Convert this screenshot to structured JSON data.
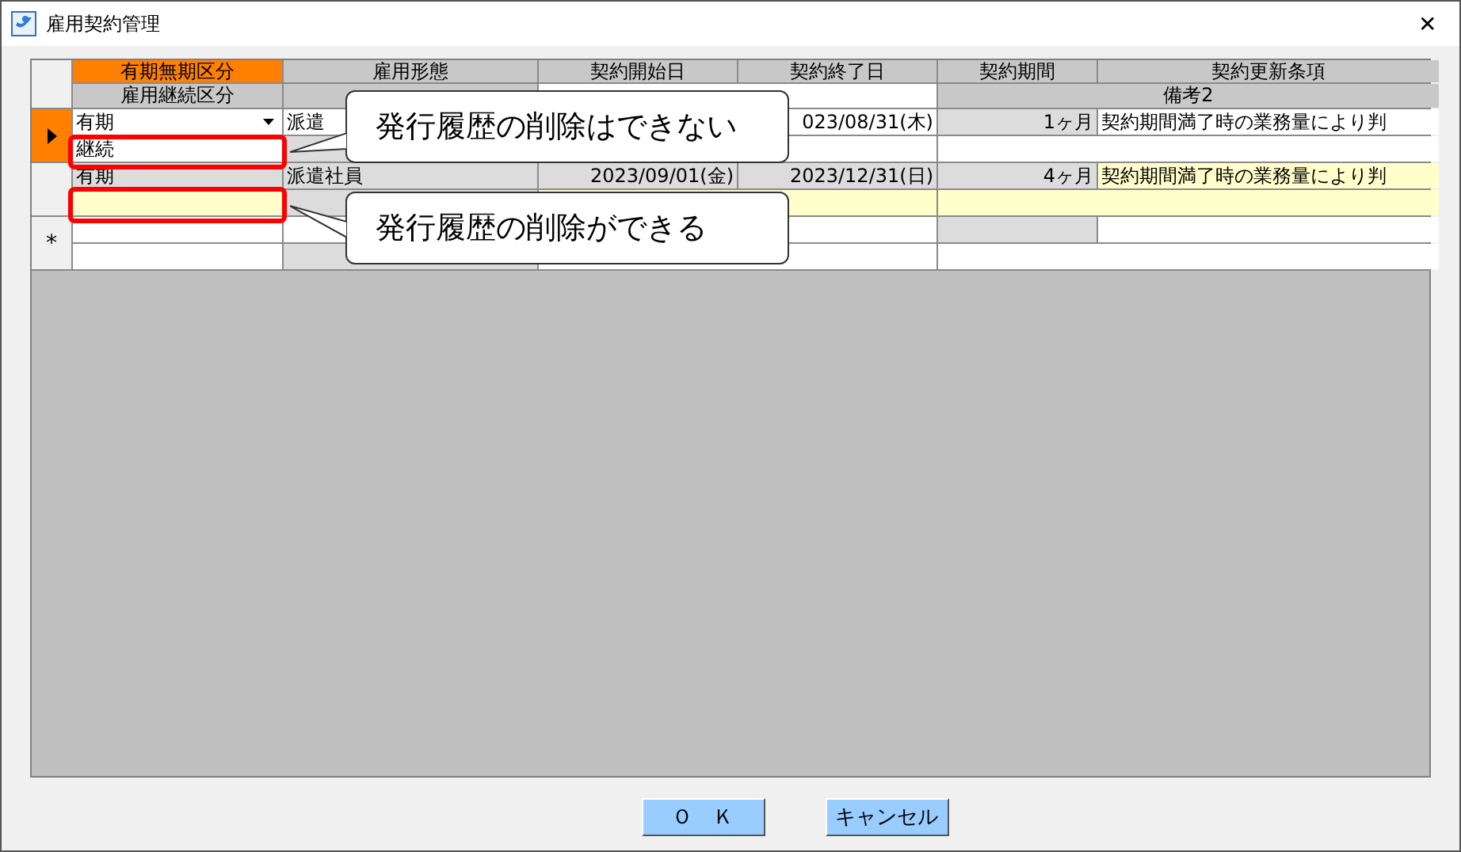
{
  "window": {
    "title": "雇用契約管理",
    "close": "✕"
  },
  "columns": [
    {
      "label": "有期無期区分",
      "selected": true
    },
    {
      "label": "雇用形態",
      "selected": false
    },
    {
      "label": "契約開始日",
      "selected": false
    },
    {
      "label": "契約終了日",
      "selected": false
    },
    {
      "label": "契約期間",
      "selected": false
    },
    {
      "label": "契約更新条項",
      "selected": false
    }
  ],
  "second_header": {
    "continuation": "雇用継続区分",
    "remarks_2": "備考2"
  },
  "records": [
    {
      "selected": true,
      "highlighted": false,
      "term_type": "有期",
      "employment": "派遣",
      "end_date": "023/08/31(木)",
      "period": "1ヶ月",
      "renewal_clause": "契約期間満了時の業務量により判",
      "continuation": "継続"
    },
    {
      "selected": false,
      "highlighted": true,
      "term_type": "有期",
      "employment": "派遣社員",
      "start_date": "2023/09/01(金)",
      "end_date": "2023/12/31(日)",
      "period": "4ヶ月",
      "renewal_clause": "契約期間満了時の業務量により判"
    }
  ],
  "new_row": {
    "marker": "*"
  },
  "callouts": [
    {
      "text": "発行履歴の削除はできない"
    },
    {
      "text": "発行履歴の削除ができる"
    }
  ],
  "buttons": [
    {
      "label": "Ｏ　Ｋ"
    },
    {
      "label": "キャンセル"
    }
  ]
}
